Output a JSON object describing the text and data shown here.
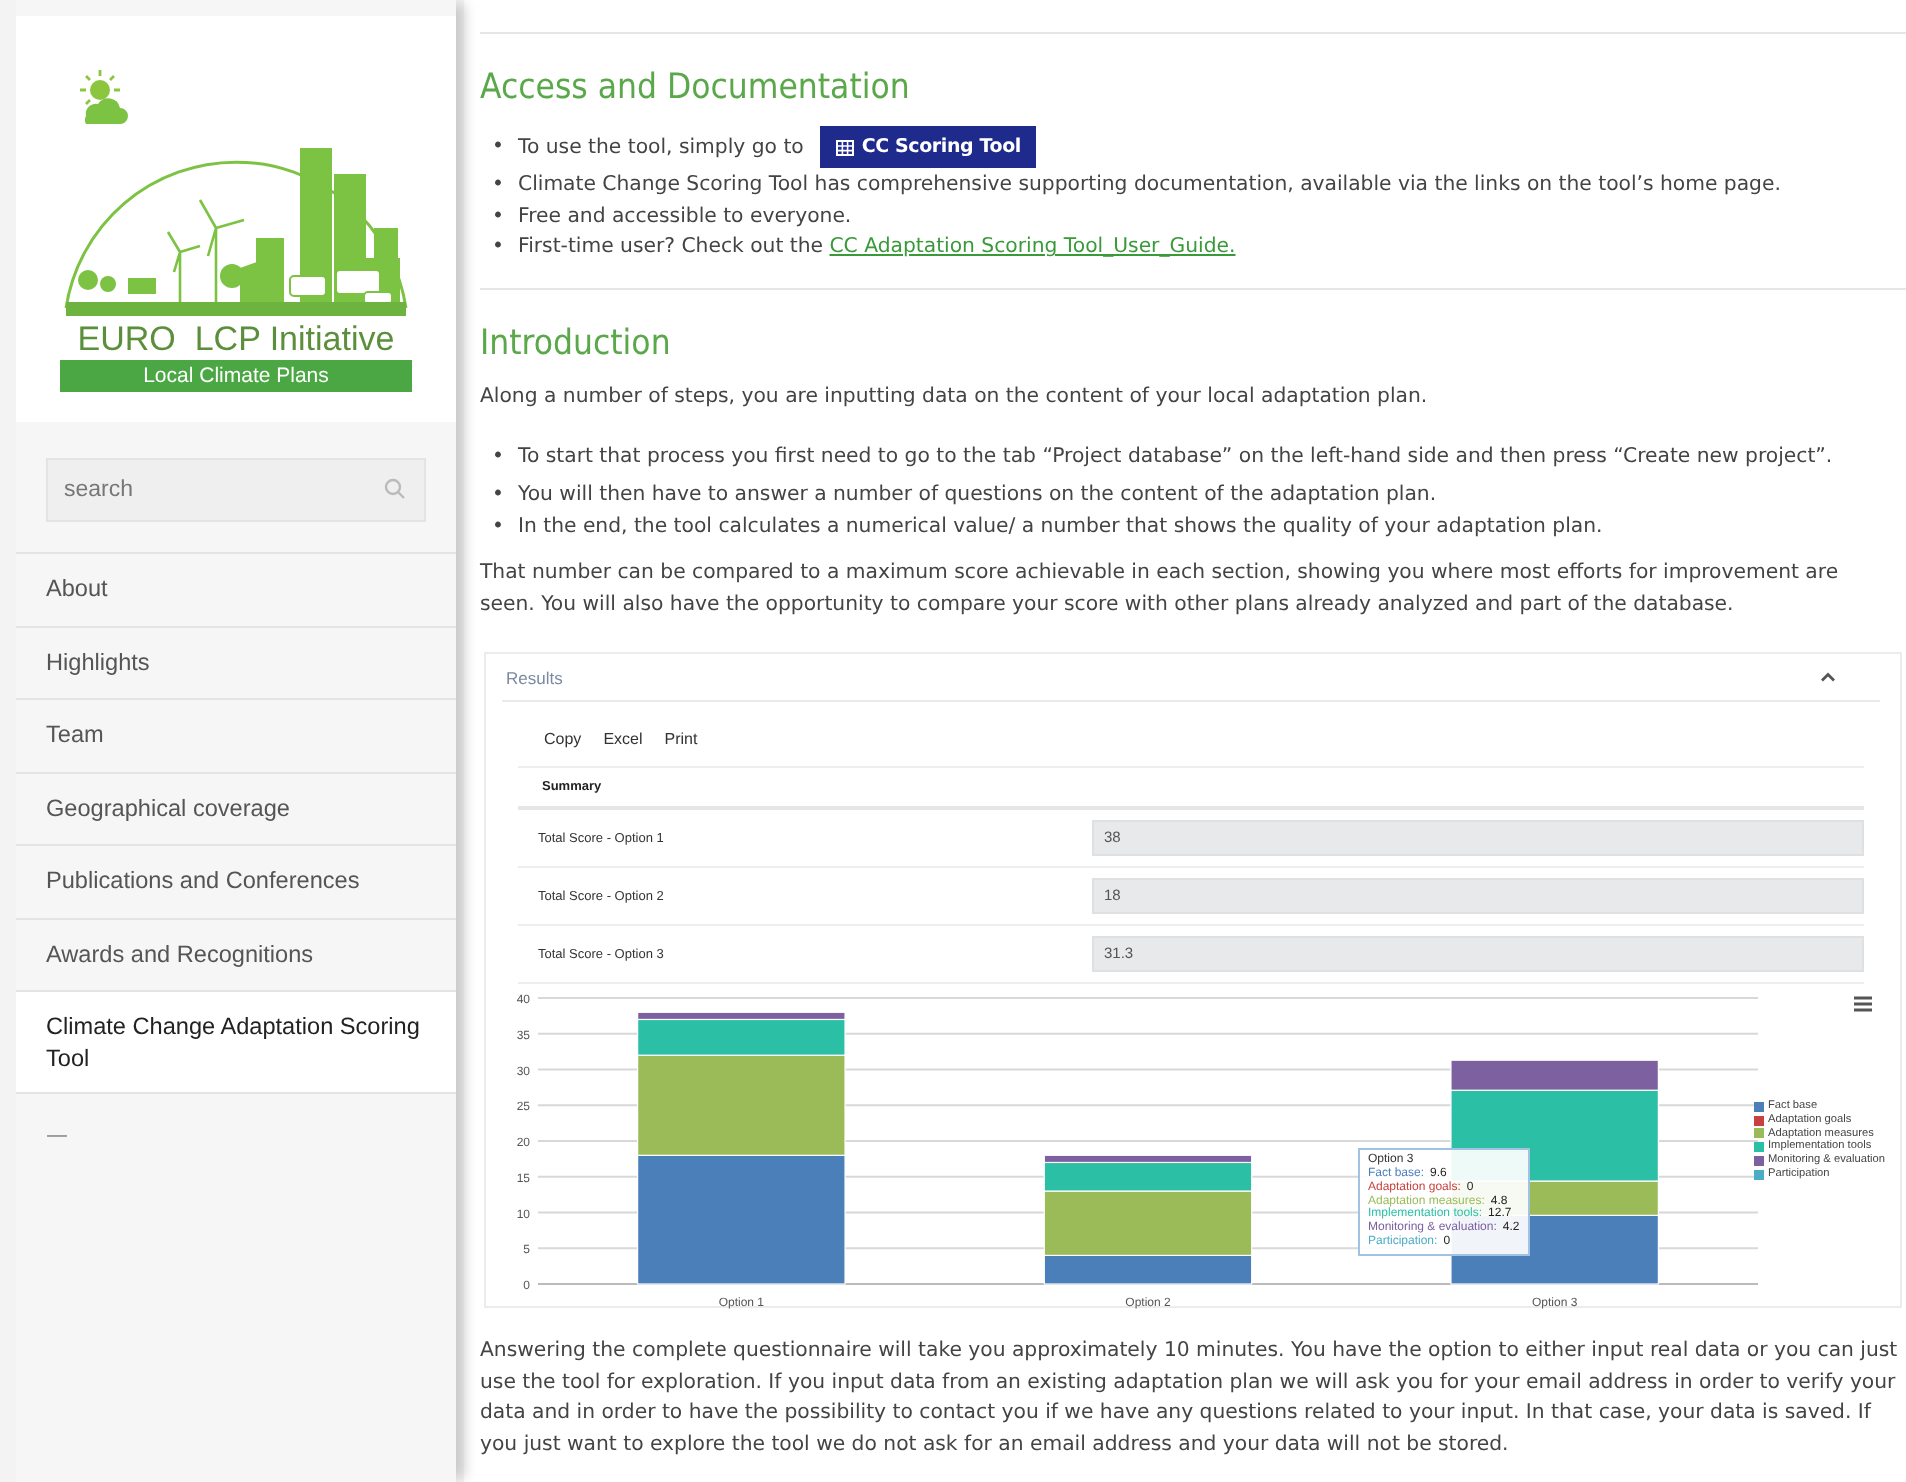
{
  "sidebar": {
    "logo": {
      "title": "EURO  LCP Initiative",
      "subtitle": "Local Climate Plans"
    },
    "search": {
      "placeholder": "search"
    },
    "items": [
      {
        "label": "About",
        "selected": false
      },
      {
        "label": "Highlights",
        "selected": false
      },
      {
        "label": "Team",
        "selected": false
      },
      {
        "label": "Geographical coverage",
        "selected": false
      },
      {
        "label": "Publications and Conferences",
        "selected": false
      },
      {
        "label": "Awards and Recognitions",
        "selected": false
      },
      {
        "label": "Climate Change Adaptation Scoring Tool",
        "selected": true
      }
    ],
    "footer_mark": "—"
  },
  "access": {
    "heading": "Access and Documentation",
    "marker": "•",
    "bullets": [
      {
        "kind": "button",
        "text": "To use the tool, simply go to",
        "button": "CC Scoring Tool"
      },
      {
        "kind": "plain",
        "text": "Climate Change Scoring Tool has comprehensive supporting documentation, available via the links on the tool’s home page."
      },
      {
        "kind": "plain",
        "text": "Free and accessible to everyone."
      },
      {
        "kind": "link",
        "text": "First-time user? Check out the",
        "link": "CC Adaptation Scoring Tool_User_Guide."
      }
    ]
  },
  "introduction": {
    "heading": "Introduction",
    "marker": "•",
    "lead": "Along a number of steps, you are inputting data on the content of your local adaptation plan.",
    "bullets": [
      "To start that process you first need to go to the tab “Project database” on the left-hand side and then press “Create new project”.",
      "You will then have to answer a number of questions on the content of the adaptation plan.",
      "In the end, the tool calculates a numerical value/ a number that shows the quality of your adaptation plan."
    ],
    "paragraph": "That number can be compared to a maximum score achievable in each section, showing you where most efforts for improvement are seen. You will also have the opportunity to compare your score with other plans already analyzed and part of the database."
  },
  "results": {
    "title": "Results",
    "toolbar": [
      "Copy",
      "Excel",
      "Print"
    ],
    "summary_heading": "Summary",
    "rows": [
      {
        "label": "Total Score - Option 1",
        "value": "38"
      },
      {
        "label": "Total Score - Option 2",
        "value": "18"
      },
      {
        "label": "Total Score - Option 3",
        "value": "31.3"
      }
    ],
    "chart_data": {
      "type": "bar",
      "stacked": true,
      "grid": true,
      "legend": true,
      "categories": [
        "Option 1",
        "Option 2",
        "Option 3"
      ],
      "ylim": [
        0,
        40
      ],
      "yticks": [
        0,
        5,
        10,
        15,
        20,
        25,
        30,
        35,
        40
      ],
      "series": [
        {
          "name": "Fact base",
          "color": "#4a7fba",
          "values": [
            18,
            4,
            9.6
          ]
        },
        {
          "name": "Adaptation goals",
          "color": "#c9413f",
          "values": [
            0,
            0,
            0
          ]
        },
        {
          "name": "Adaptation measures",
          "color": "#9bbb59",
          "values": [
            14,
            9,
            4.8
          ]
        },
        {
          "name": "Implementation tools",
          "color": "#2bbfa5",
          "values": [
            5,
            4,
            12.7
          ]
        },
        {
          "name": "Monitoring & evaluation",
          "color": "#7d60a0",
          "values": [
            1,
            1,
            4.2
          ]
        },
        {
          "name": "Participation",
          "color": "#4bacc6",
          "values": [
            0,
            0,
            0
          ]
        }
      ]
    },
    "tooltip": {
      "title": "Option 3",
      "rows": [
        {
          "label": "Fact base:",
          "value": "9.6"
        },
        {
          "label": "Adaptation goals:",
          "value": "0"
        },
        {
          "label": "Adaptation measures:",
          "value": "4.8"
        },
        {
          "label": "Implementation tools:",
          "value": "12.7"
        },
        {
          "label": "Monitoring & evaluation:",
          "value": "4.2"
        },
        {
          "label": "Participation:",
          "value": "0"
        }
      ]
    }
  },
  "closing": "Answering the complete questionnaire will take you approximately 10 minutes. You have the option to either input real data or you can just use the tool for exploration. If you input data from an existing adaptation plan we will ask you for your email address in order to verify your data and in order to have the possibility to contact you if we have any questions related to your input. In that case, your data is saved. If you just want to explore the tool we do not ask for an email address and your data will not be stored."
}
